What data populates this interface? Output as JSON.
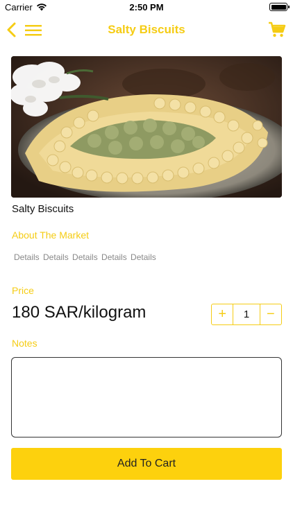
{
  "status_bar": {
    "carrier": "Carrier",
    "time": "2:50 PM"
  },
  "nav": {
    "title": "Salty Biscuits",
    "back_icon": "chevron-left-icon",
    "menu_icon": "hamburger-menu-icon",
    "cart_icon": "cart-icon"
  },
  "product": {
    "name": "Salty Biscuits",
    "about_label": "About The Market",
    "details": "Details Details  Details  Details  Details",
    "price_label": "Price",
    "price": "180 SAR/kilogram",
    "quantity": "1",
    "increment_symbol": "+",
    "decrement_symbol": "−",
    "notes_label": "Notes",
    "notes_value": ""
  },
  "actions": {
    "add_to_cart": "Add To Cart"
  },
  "colors": {
    "accent": "#f5cc14",
    "button": "#fdd10d"
  }
}
